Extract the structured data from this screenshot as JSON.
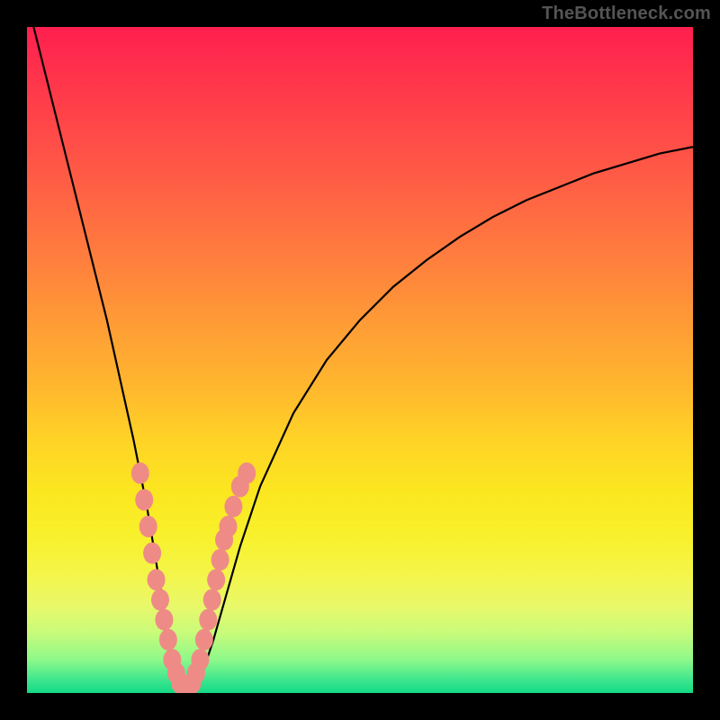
{
  "attribution": "TheBottleneck.com",
  "colors": {
    "frame": "#000000",
    "curve": "#000000",
    "points": "#ef8b86",
    "gradient_top": "#ff1f4f",
    "gradient_bottom": "#13d986"
  },
  "chart_data": {
    "type": "line",
    "title": "",
    "xlabel": "",
    "ylabel": "",
    "xlim": [
      0,
      100
    ],
    "ylim": [
      0,
      100
    ],
    "grid": false,
    "series": [
      {
        "name": "bottleneck-curve",
        "x": [
          1,
          2,
          3,
          4,
          6,
          8,
          10,
          12,
          14,
          16,
          18,
          19,
          20,
          21,
          22,
          23,
          24,
          25,
          26,
          28,
          30,
          32,
          35,
          40,
          45,
          50,
          55,
          60,
          65,
          70,
          75,
          80,
          85,
          90,
          95,
          100
        ],
        "y": [
          100,
          96,
          92,
          88,
          80,
          72,
          64,
          56,
          47,
          38,
          28,
          22,
          16,
          10,
          5,
          2,
          0.5,
          0.5,
          2,
          8,
          15,
          22,
          31,
          42,
          50,
          56,
          61,
          65,
          68.5,
          71.5,
          74,
          76,
          78,
          79.5,
          81,
          82
        ]
      }
    ],
    "points": {
      "name": "sample-markers",
      "x": [
        17,
        17.6,
        18.2,
        18.8,
        19.4,
        20,
        20.6,
        21.2,
        21.8,
        22.4,
        23,
        23.6,
        24.2,
        24.8,
        25.4,
        26,
        26.6,
        27.2,
        27.8,
        28.4,
        29,
        29.6,
        30.2,
        31,
        32,
        33
      ],
      "y": [
        33,
        29,
        25,
        21,
        17,
        14,
        11,
        8,
        5,
        3,
        1.5,
        1,
        1,
        1.5,
        3,
        5,
        8,
        11,
        14,
        17,
        20,
        23,
        25,
        28,
        31,
        33
      ]
    }
  }
}
